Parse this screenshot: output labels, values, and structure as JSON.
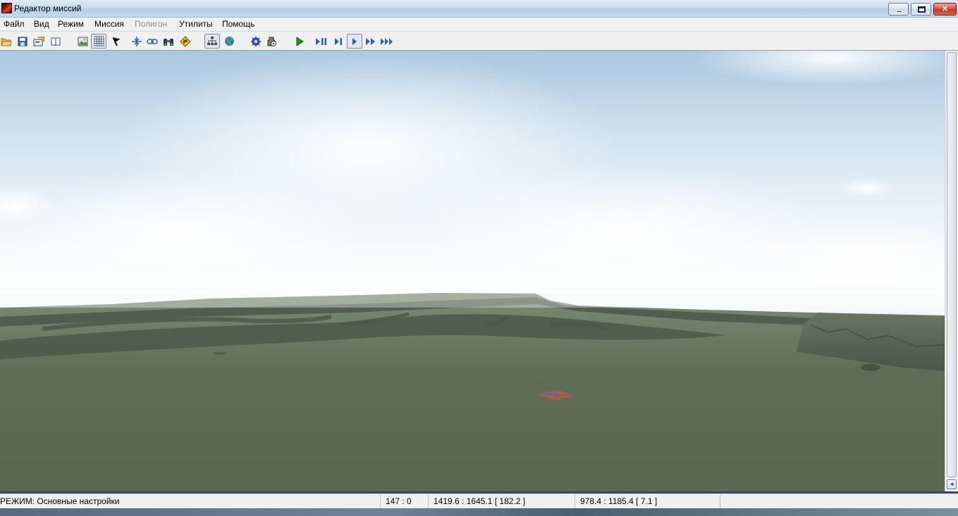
{
  "window": {
    "title": "Редактор миссий"
  },
  "menu": {
    "items": [
      {
        "label": "Файл",
        "enabled": true
      },
      {
        "label": "Вид",
        "enabled": true
      },
      {
        "label": "Режим",
        "enabled": true
      },
      {
        "label": "Миссия",
        "enabled": true
      },
      {
        "label": "Полигон",
        "enabled": false
      },
      {
        "label": "Утилиты",
        "enabled": true
      },
      {
        "label": "Помощь",
        "enabled": true
      }
    ]
  },
  "toolbar": {
    "buttons": [
      {
        "icon": "open-folder-icon",
        "active": false
      },
      {
        "icon": "save-icon",
        "active": false
      },
      {
        "icon": "properties-icon",
        "active": false
      },
      {
        "icon": "book-icon",
        "active": false
      },
      {
        "icon": "map-icon",
        "active": false
      },
      {
        "icon": "grid-icon",
        "active": true
      },
      {
        "icon": "flag-icon",
        "active": false
      },
      {
        "icon": "split-icon",
        "active": false
      },
      {
        "icon": "link-icon",
        "active": false
      },
      {
        "icon": "binoculars-icon",
        "active": false
      },
      {
        "icon": "road-sign-icon",
        "active": false
      },
      {
        "icon": "hierarchy-icon",
        "active": true
      },
      {
        "icon": "globe-icon",
        "active": false
      },
      {
        "icon": "gear-icon",
        "active": false
      },
      {
        "icon": "script-icon",
        "active": false
      },
      {
        "icon": "play-icon",
        "active": false
      },
      {
        "icon": "play-pause-icon",
        "active": false
      },
      {
        "icon": "step-icon",
        "active": false
      },
      {
        "icon": "play-slow-icon",
        "active": true
      },
      {
        "icon": "fast-forward-icon",
        "active": false
      },
      {
        "icon": "fastest-forward-icon",
        "active": false
      }
    ]
  },
  "statusbar": {
    "mode": "РЕЖИМ: Основные настройки",
    "screen_pos": "147 : 0",
    "world_pos": "1419.6 : 1645.1 [ 182.2 ]",
    "target_pos": "978.4 : 1185.4 [ 7.1 ]"
  },
  "colors": {
    "accent_play": "#1a9a1a",
    "accent_blue": "#2a5fc8",
    "grass": "#5c6b55",
    "sky": "#a9c7df"
  }
}
